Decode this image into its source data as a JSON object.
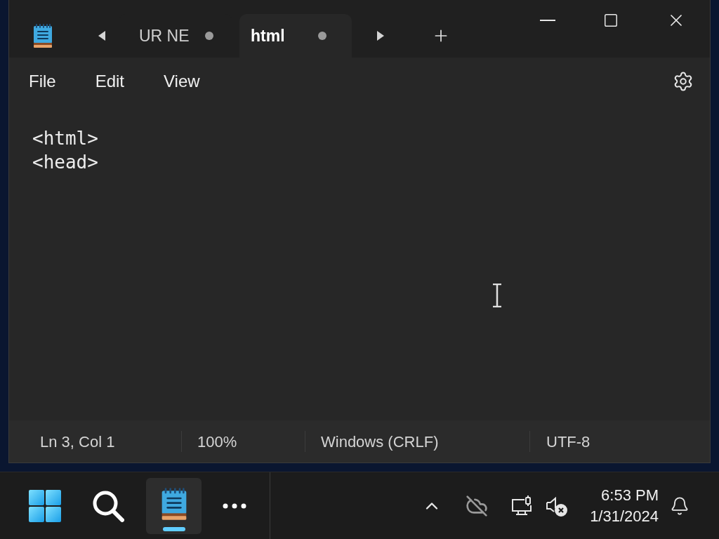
{
  "tabs": [
    {
      "label": "UR NE",
      "selected": false,
      "modified": true
    },
    {
      "label": "html",
      "selected": true,
      "modified": true
    }
  ],
  "menu": [
    "File",
    "Edit",
    "View"
  ],
  "editor": {
    "lines": [
      "<html>",
      "<head>"
    ]
  },
  "status_bar": [
    "Ln 3, Col 1",
    "100%",
    "Windows (CRLF)",
    "UTF-8"
  ],
  "taskbar": {
    "apps": [
      {
        "kind": "notepad",
        "selected": true
      }
    ],
    "clock": {
      "time": "6:53 PM",
      "date": "1/31/2024"
    }
  }
}
